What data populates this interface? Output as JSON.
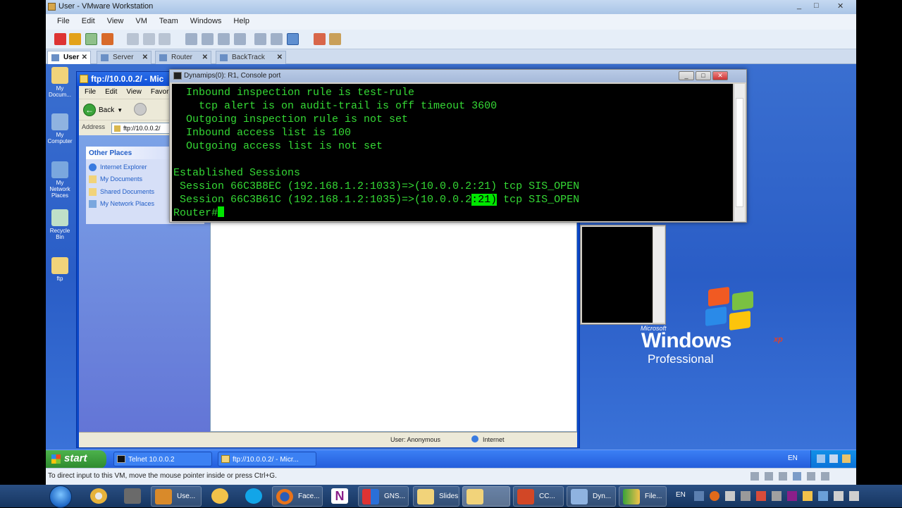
{
  "vmware": {
    "title": "User - VMware Workstation",
    "window_controls": [
      "_",
      "□",
      "✕"
    ],
    "menu": [
      "File",
      "Edit",
      "View",
      "VM",
      "Team",
      "Windows",
      "Help"
    ],
    "tabs": [
      {
        "label": "User",
        "active": true
      },
      {
        "label": "Server",
        "active": false
      },
      {
        "label": "Router",
        "active": false
      },
      {
        "label": "BackTrack",
        "active": false
      }
    ],
    "status": "To direct input to this VM, move the mouse pointer inside or press Ctrl+G."
  },
  "desktop_icons": [
    "My Docum...",
    "My Computer",
    "My Network Places",
    "Recycle Bin",
    "ftp"
  ],
  "explorer": {
    "title": "ftp://10.0.0.2/ - Mic",
    "menu": [
      "File",
      "Edit",
      "View",
      "Favori"
    ],
    "back_label": "Back",
    "address_label": "Address",
    "address": "ftp://10.0.0.2/",
    "other_places": {
      "header": "Other Places",
      "items": [
        "Internet Explorer",
        "My Documents",
        "Shared Documents",
        "My Network Places"
      ]
    },
    "status_user": "User: Anonymous",
    "status_zone": "Internet"
  },
  "telnet": {
    "title": "Dynamips(0): R1, Console port",
    "lines": [
      "  Inbound inspection rule is test-rule",
      "    tcp alert is on audit-trail is off timeout 3600",
      "  Outgoing inspection rule is not set",
      "  Inbound access list is 100",
      "  Outgoing access list is not set",
      "",
      "Established Sessions",
      " Session 66C3B8EC (192.168.1.2:1033)=>(10.0.0.2:21) tcp SIS_OPEN"
    ],
    "last_session_prefix": " Session 66C3B61C (192.168.1.2:1035)=>(10.0.0.2",
    "last_session_highlight": ":21)",
    "last_session_suffix": " tcp SIS_OPEN",
    "prompt": "Router#"
  },
  "xp_logo": {
    "microsoft": "Microsoft",
    "windows": "Windows",
    "xp": "xp",
    "edition": "Professional"
  },
  "guest_taskbar": {
    "start": "start",
    "buttons": [
      "Telnet 10.0.0.2",
      "ftp://10.0.0.2/ - Micr..."
    ],
    "lang": "EN"
  },
  "host_taskbar": {
    "buttons": [
      "Use...",
      "GNS...",
      "Slides",
      "CC...",
      "Dyn...",
      "File..."
    ],
    "lang": "EN"
  }
}
